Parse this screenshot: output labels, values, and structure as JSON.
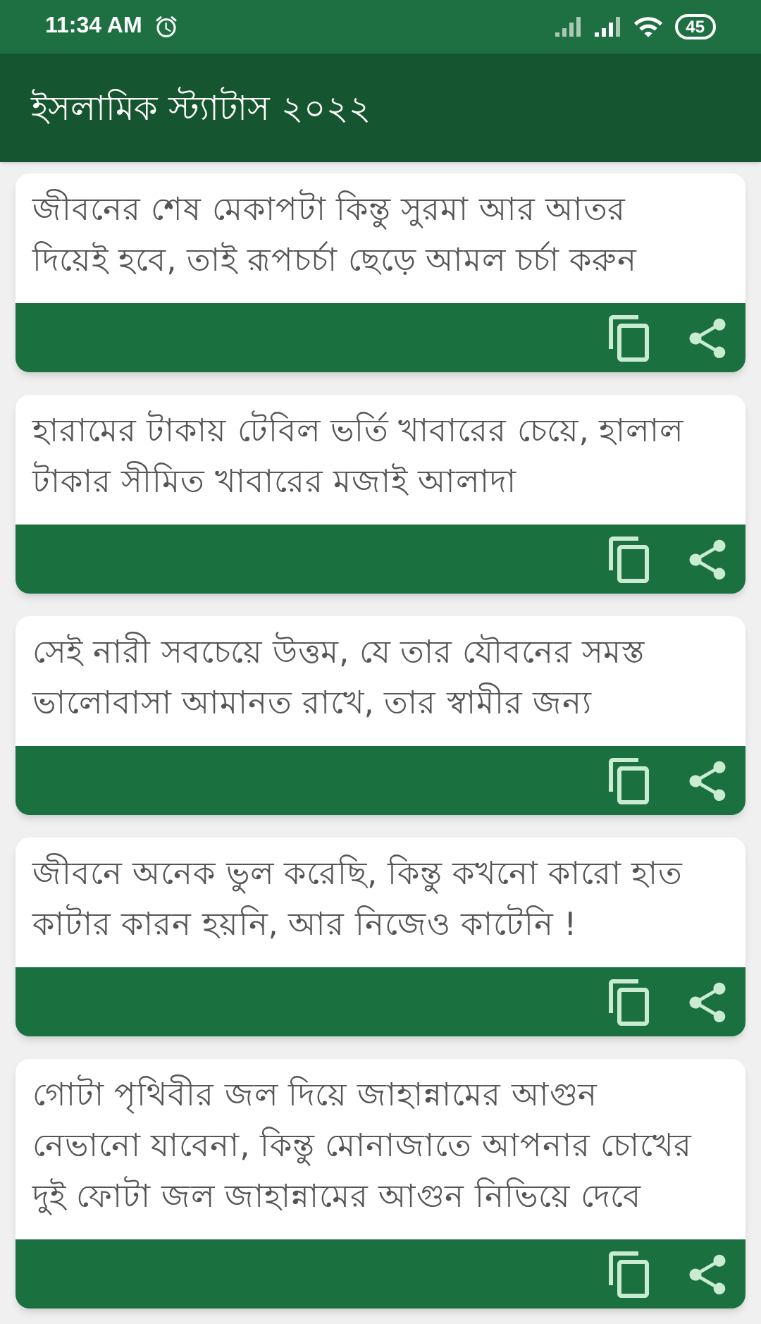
{
  "status_bar": {
    "time": "11:34 AM",
    "battery": "45"
  },
  "app_bar": {
    "title": "ইসলামিক স্ট্যাটাস ২০২২"
  },
  "statuses": [
    {
      "text": "জীবনের শেষ মেকাপটা কিন্তু সুরমা আর আতর দিয়েই হবে, তাই রূপচর্চা ছেড়ে আমল চর্চা করুন"
    },
    {
      "text": "হারামের টাকায় টেবিল ভর্তি খাবারের চেয়ে, হালাল টাকার সীমিত খাবারের মজাই আলাদা"
    },
    {
      "text": "সেই নারী সবচেয়ে উত্তম, যে তার যৌবনের সমস্ত ভালোবাসা আমানত রাখে, তার স্বামীর জন্য"
    },
    {
      "text": "জীবনে অনেক ভুল করেছি, কিন্তু কখনো কারো হাত কাটার কারন হয়নি, আর নিজেও কাটেনি !"
    },
    {
      "text": "গোটা পৃথিবীর জল দিয়ে জাহান্নামের আগুন নেভানো যাবেনা, কিন্তু মোনাজাতে আপনার চোখের দুই ফোটা জল জাহান্নামের আগুন নিভিয়ে দেবে"
    }
  ]
}
